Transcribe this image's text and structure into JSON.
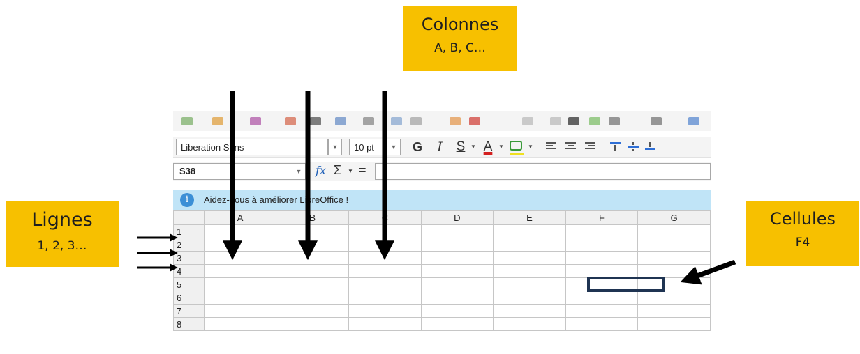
{
  "callouts": {
    "colonnes": {
      "title": "Colonnes",
      "subtitle": "A, B, C…"
    },
    "lignes": {
      "title": "Lignes",
      "subtitle": "1, 2, 3…"
    },
    "cellules": {
      "title": "Cellules",
      "subtitle": "F4"
    }
  },
  "toolbar": {
    "font_name": "Liberation Sans",
    "font_size": "10 pt",
    "bold": "G",
    "italic": "I",
    "underline": "S",
    "font_color": "A"
  },
  "formula_bar": {
    "name_box": "S38",
    "fx": "fx",
    "sum": "Σ",
    "equals": "="
  },
  "infobar": {
    "icon": "i",
    "text": "Aidez-nous à améliorer LibreOffice !"
  },
  "sheet": {
    "columns": [
      "A",
      "B",
      "C",
      "D",
      "E",
      "F",
      "G"
    ],
    "rows": [
      "1",
      "2",
      "3",
      "4",
      "5",
      "6",
      "7",
      "8"
    ],
    "highlighted_cell": "F4"
  },
  "colors": {
    "callout": "#f7c000",
    "infobar": "#c0e4f7",
    "highlight_border": "#1f3452",
    "arrow": "#000000"
  }
}
